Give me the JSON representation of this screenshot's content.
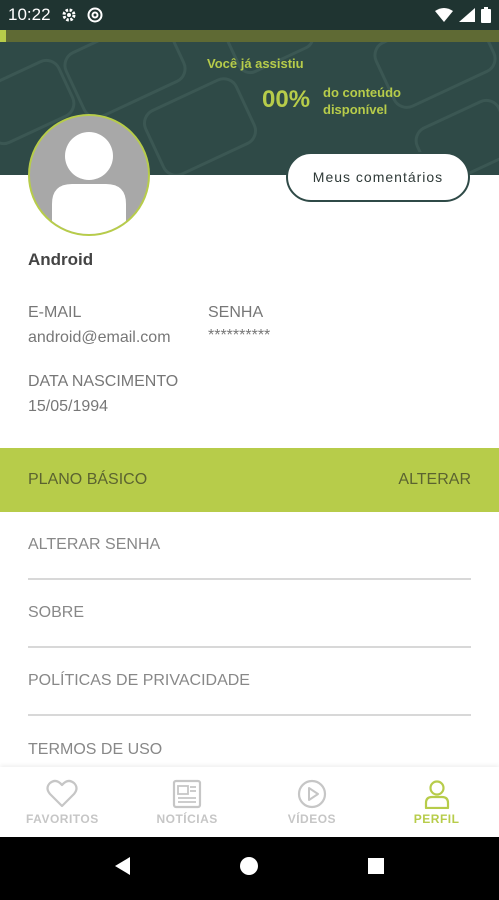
{
  "status_bar": {
    "time": "10:22"
  },
  "header": {
    "watched_label": "Você já assistiu",
    "watched_percent": "00%",
    "watched_suffix": "do conteúdo disponível",
    "comments_button": "Meus comentários"
  },
  "profile": {
    "name": "Android",
    "email_label": "E-MAIL",
    "email_value": "android@email.com",
    "password_label": "SENHA",
    "password_value": "**********",
    "birth_label": "DATA NASCIMENTO",
    "birth_value": "15/05/1994"
  },
  "plan": {
    "name": "PLANO BÁSICO",
    "change_label": "ALTERAR"
  },
  "menu": {
    "items": [
      {
        "label": "ALTERAR SENHA"
      },
      {
        "label": "SOBRE"
      },
      {
        "label": "POLÍTICAS DE PRIVACIDADE"
      },
      {
        "label": "TERMOS DE USO"
      }
    ]
  },
  "bottom_nav": {
    "items": [
      {
        "label": "FAVORITOS",
        "icon": "heart-icon"
      },
      {
        "label": "NOTÍCIAS",
        "icon": "newspaper-icon"
      },
      {
        "label": "VÍDEOS",
        "icon": "play-circle-icon"
      },
      {
        "label": "PERFIL",
        "icon": "person-icon",
        "active": true
      }
    ]
  },
  "colors": {
    "accent": "#b7cc4a",
    "header_bg": "#2f4a47",
    "status_bg": "#1f3431"
  }
}
